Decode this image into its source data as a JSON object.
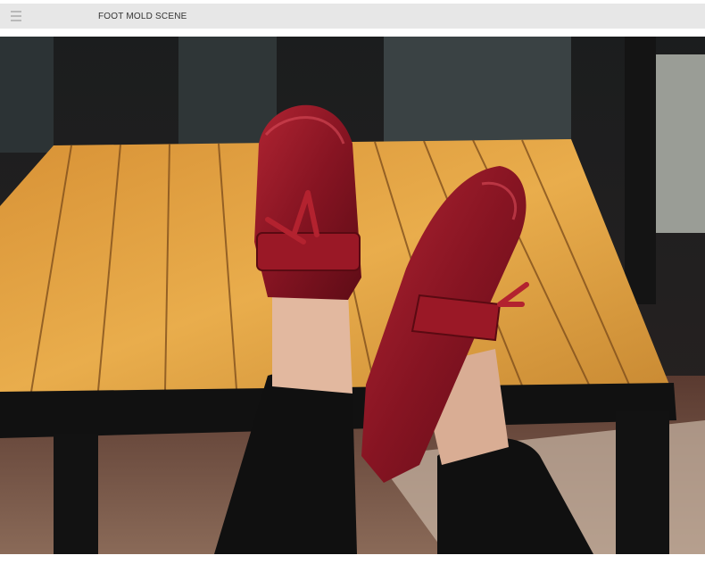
{
  "header": {
    "title": "FOOT MOLD SCENE",
    "menu_icon": "hamburger-menu-icon"
  },
  "photo": {
    "subject": "product-scene-photo"
  },
  "colors": {
    "header_bg": "#e7e7e7",
    "header_text": "#333333",
    "wood": "#e2a13e",
    "shoe": "#8a1420",
    "pants": "#121212"
  }
}
